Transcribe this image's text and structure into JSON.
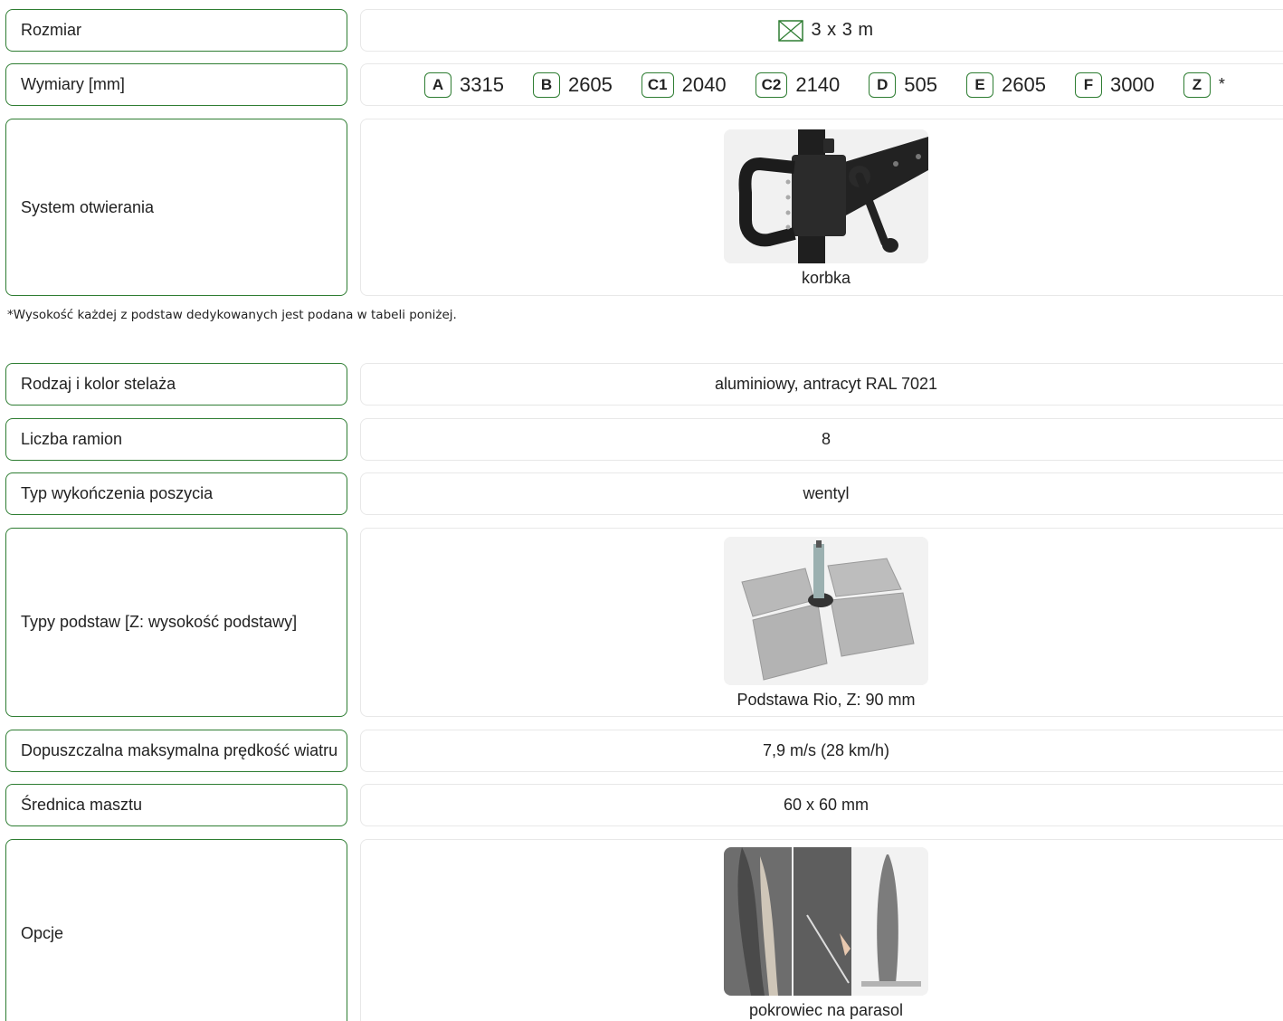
{
  "rows_top": [
    {
      "label": "Rozmiar"
    },
    {
      "label": "Wymiary [mm]"
    },
    {
      "label": "System otwierania"
    }
  ],
  "size": {
    "value": "3 x 3 m",
    "icon": "square-x-icon",
    "accent": "#2e7d32"
  },
  "dimensions": [
    {
      "key": "A",
      "value": "3315"
    },
    {
      "key": "B",
      "value": "2605"
    },
    {
      "key": "C1",
      "value": "2040"
    },
    {
      "key": "C2",
      "value": "2140"
    },
    {
      "key": "D",
      "value": "505"
    },
    {
      "key": "E",
      "value": "2605"
    },
    {
      "key": "F",
      "value": "3000"
    },
    {
      "key": "Z",
      "value": "*"
    }
  ],
  "opening_system": {
    "caption": "korbka"
  },
  "footnote": "*Wysokość każdej z podstaw dedykowanych jest podana w tabeli poniżej.",
  "rows_bottom": [
    {
      "label": "Rodzaj i kolor stelaża",
      "value": "aluminiowy, antracyt RAL 7021"
    },
    {
      "label": "Liczba ramion",
      "value": "8"
    },
    {
      "label": "Typ wykończenia poszycia",
      "value": "wentyl"
    },
    {
      "label": "Typy podstaw [Z: wysokość podstawy]",
      "caption": "Podstawa Rio, Z: 90 mm"
    },
    {
      "label": "Dopuszczalna maksymalna prędkość wiatru",
      "value": "7,9 m/s (28 km/h)"
    },
    {
      "label": "Średnica masztu",
      "value": "60 x 60 mm"
    },
    {
      "label": "Opcje",
      "caption": "pokrowiec na parasol"
    }
  ]
}
